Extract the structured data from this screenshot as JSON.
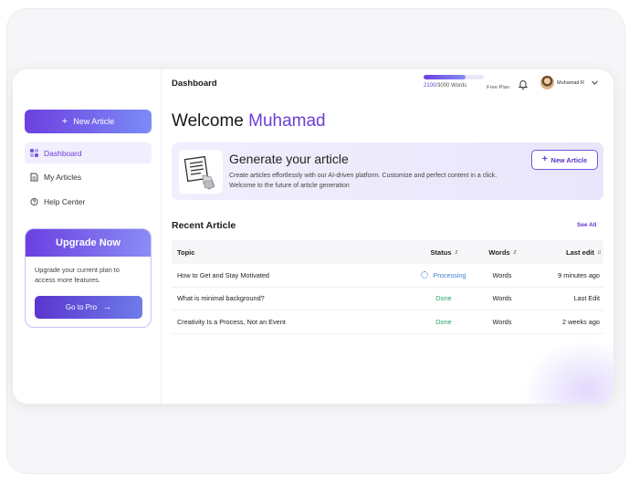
{
  "sidebar": {
    "new_article_label": "New Article",
    "items": [
      {
        "label": "Dashboard",
        "icon": "dashboard-grid-icon",
        "active": true
      },
      {
        "label": "My Articles",
        "icon": "document-icon",
        "active": false
      },
      {
        "label": "Help Center",
        "icon": "help-circle-icon",
        "active": false
      }
    ],
    "upgrade": {
      "title": "Upgrade Now",
      "text": "Upgrade your current plan to access more features.",
      "button_label": "Go to Pro"
    }
  },
  "header": {
    "title": "Dashboard",
    "usage": {
      "used": "2100",
      "total": "/3000 Words",
      "fraction": 0.7
    },
    "plan": "Free Plan",
    "user_name": "Muhamad R"
  },
  "welcome": {
    "prefix": "Welcome",
    "name": "Muhamad"
  },
  "banner": {
    "title": "Generate your article",
    "description": "Create articles effortlessly with our AI-driven platform. Customize and perfect content in a click. Welcome to the future of article generation",
    "button_label": "New Article"
  },
  "recent": {
    "title": "Recent Article",
    "see_all": "See All",
    "columns": {
      "topic": "Topic",
      "status": "Status",
      "words": "Words",
      "last_edit": "Last edit"
    },
    "rows": [
      {
        "topic": "How to Get and Stay Motivated",
        "status": "Processing",
        "words": "Words",
        "last_edit": "9 minutes ago"
      },
      {
        "topic": "What is minimal background?",
        "status": "Done",
        "words": "Words",
        "last_edit": "Last Edit"
      },
      {
        "topic": "Creativity Is a Process, Not an Event",
        "status": "Done",
        "words": "Words",
        "last_edit": "2 weeks ago"
      }
    ]
  },
  "colors": {
    "accent": "#6a3fd8",
    "processing": "#3f7fd6",
    "done": "#23a86b"
  }
}
